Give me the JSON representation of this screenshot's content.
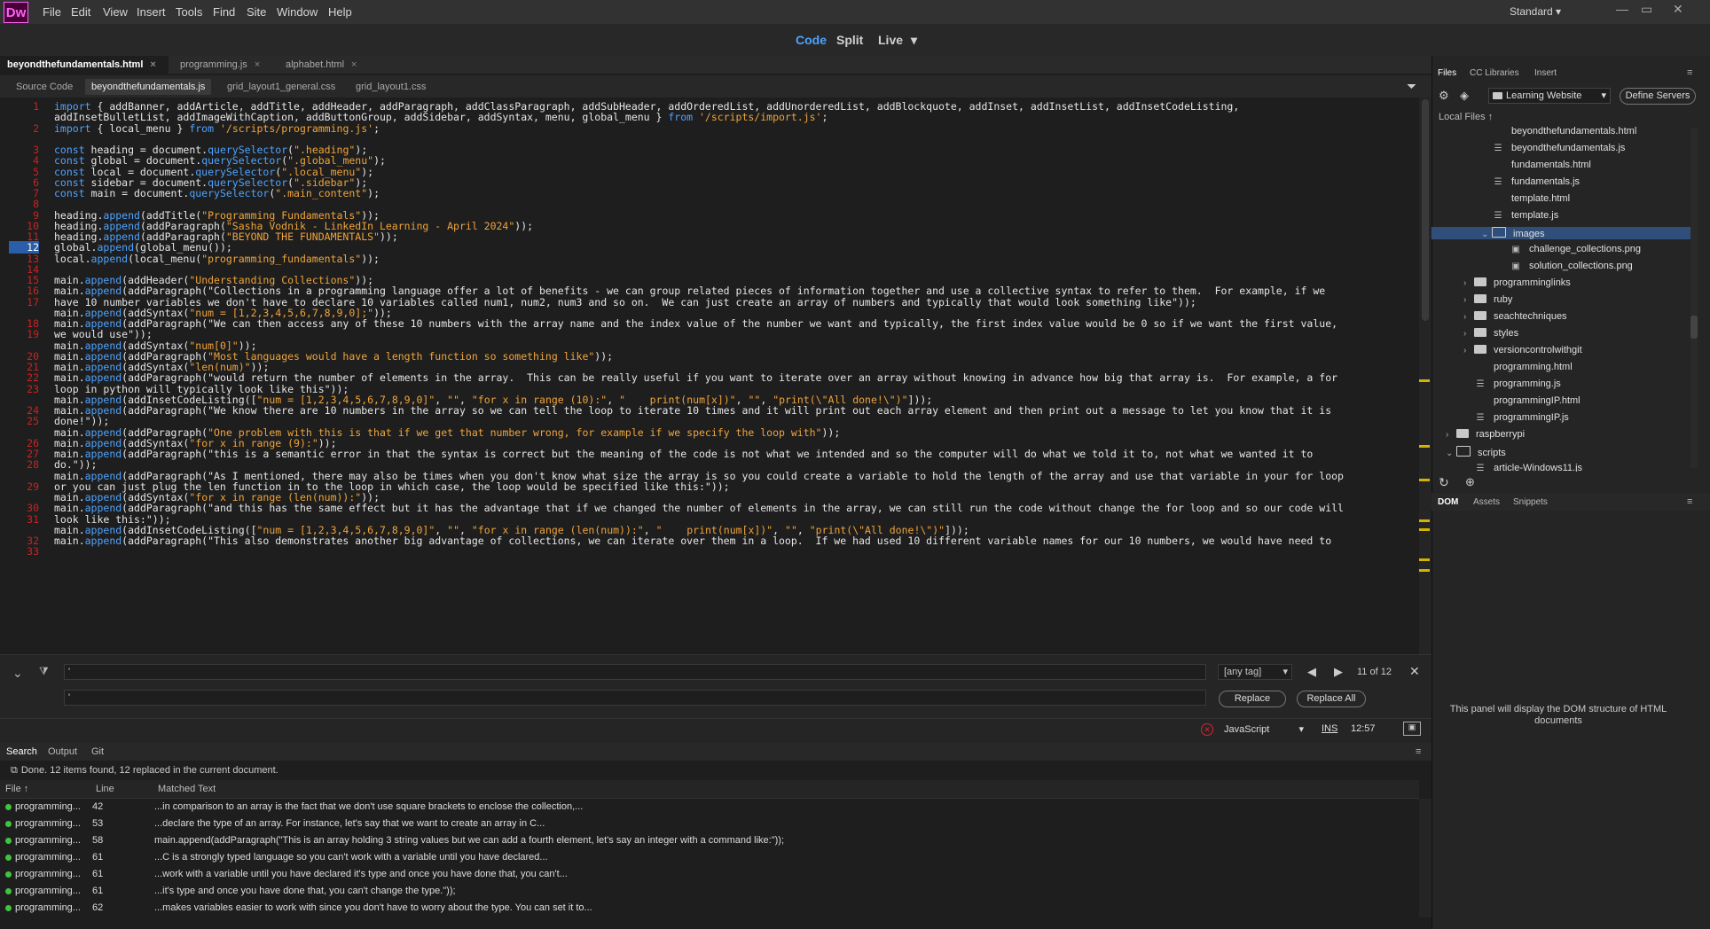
{
  "app": {
    "logo": "Dw",
    "menu": [
      "File",
      "Edit",
      "View",
      "Insert",
      "Tools",
      "Find",
      "Site",
      "Window",
      "Help"
    ],
    "workspace": "Standard",
    "workspace_arrow": "▾",
    "window_controls": [
      "—",
      "▭",
      "✕"
    ]
  },
  "view_modes": {
    "code": "Code",
    "split": "Split",
    "live": "Live",
    "live_arrow": "▾"
  },
  "doc_tabs": [
    {
      "label": "beyondthefundamentals.html",
      "close": "×"
    },
    {
      "label": "programming.js",
      "close": "×"
    },
    {
      "label": "alphabet.html",
      "close": "×"
    }
  ],
  "related_files": [
    "Source Code",
    "beyondthefundamentals.js",
    "grid_layout1_general.css",
    "grid_layout1.css"
  ],
  "filter_icon": "⏷",
  "code": {
    "line_numbers": [
      "1",
      "",
      "2",
      "",
      "3",
      "4",
      "5",
      "6",
      "7",
      "8",
      "9",
      "10",
      "11",
      "12",
      "13",
      "14",
      "15",
      "16",
      "17",
      "",
      "18",
      "19",
      "",
      "20",
      "21",
      "22",
      "23",
      "",
      "24",
      "25",
      "",
      "26",
      "27",
      "28",
      "",
      "29",
      "",
      "30",
      "31",
      "",
      "32",
      "33"
    ],
    "current_line": "12",
    "lines": [
      "import { addBanner, addArticle, addTitle, addHeader, addParagraph, addClassParagraph, addSubHeader, addOrderedList, addUnorderedList, addBlockquote, addInset, addInsetList, addInsetCodeListing,",
      "addInsetBulletList, addImageWithCaption, addButtonGroup, addSidebar, addSyntax, menu, global_menu } from '/scripts/import.js';",
      "import { local_menu } from '/scripts/programming.js';",
      "",
      "const heading = document.querySelector(\".heading\");",
      "const global = document.querySelector(\".global_menu\");",
      "const local = document.querySelector(\".local_menu\");",
      "const sidebar = document.querySelector(\".sidebar\");",
      "const main = document.querySelector(\".main_content\");",
      "",
      "heading.append(addTitle(\"Programming Fundamentals\"));",
      "heading.append(addParagraph(\"Sasha Vodnik - LinkedIn Learning - April 2024\"));",
      "heading.append(addParagraph(\"BEYOND THE FUNDAMENTALS\"));",
      "global.append(global_menu());",
      "local.append(local_menu(\"programming_fundamentals\"));",
      "",
      "main.append(addHeader(\"Understanding Collections\"));",
      "main.append(addParagraph(\"Collections in a programming language offer a lot of benefits - we can group related pieces of information together and use a collective syntax to refer to them.  For example, if we",
      "have 10 number variables we don't have to declare 10 variables called num1, num2, num3 and so on.  We can just create an array of numbers and typically that would look something like\"));",
      "main.append(addSyntax(\"num = [1,2,3,4,5,6,7,8,9,0];\"));",
      "main.append(addParagraph(\"We can then access any of these 10 numbers with the array name and the index value of the number we want and typically, the first index value would be 0 so if we want the first value,",
      "we would use\"));",
      "main.append(addSyntax(\"num[0]\"));",
      "main.append(addParagraph(\"Most languages would have a length function so something like\"));",
      "main.append(addSyntax(\"len(num)\"));",
      "main.append(addParagraph(\"would return the number of elements in the array.  This can be really useful if you want to iterate over an array without knowing in advance how big that array is.  For example, a for",
      "loop in python will typically look like this\"));",
      "main.append(addInsetCodeListing([\"num = [1,2,3,4,5,6,7,8,9,0]\", \"\", \"for x in range (10):\", \"    print(num[x])\", \"\", \"print(\\\"All done!\\\")\"]));",
      "main.append(addParagraph(\"We know there are 10 numbers in the array so we can tell the loop to iterate 10 times and it will print out each array element and then print out a message to let you know that it is",
      "done!\"));",
      "main.append(addParagraph(\"One problem with this is that if we get that number wrong, for example if we specify the loop with\"));",
      "main.append(addSyntax(\"for x in range (9):\"));",
      "main.append(addParagraph(\"this is a semantic error in that the syntax is correct but the meaning of the code is not what we intended and so the computer will do what we told it to, not what we wanted it to",
      "do.\"));",
      "main.append(addParagraph(\"As I mentioned, there may also be times when you don't know what size the array is so you could create a variable to hold the length of the array and use that variable in your for loop",
      "or you can just plug the len function in to the loop in which case, the loop would be specified like this:\"));",
      "main.append(addSyntax(\"for x in range (len(num)):\"));",
      "main.append(addParagraph(\"and this has the same effect but it has the advantage that if we changed the number of elements in the array, we can still run the code without change the for loop and so our code will",
      "look like this:\"));",
      "main.append(addInsetCodeListing([\"num = [1,2,3,4,5,6,7,8,9,0]\", \"\", \"for x in range (len(num)):\", \"    print(num[x])\", \"\", \"print(\\\"All done!\\\")\"]));",
      "main.append(addParagraph(\"This also demonstrates another big advantage of collections, we can iterate over them in a loop.  If we had used 10 different variable names for our 10 numbers, we would have need to"
    ]
  },
  "find": {
    "search_value": "'",
    "replace_value": "'",
    "tag_select": "[any tag]",
    "count": "11 of 12",
    "replace_label": "Replace",
    "replace_all_label": "Replace All",
    "close": "✕",
    "prev": "◀",
    "next": "▶",
    "collapse": "⌄"
  },
  "status": {
    "language": "JavaScript",
    "mode": "INS",
    "position": "12:57"
  },
  "bottom_tabs": [
    "Search",
    "Output",
    "Git"
  ],
  "search": {
    "message": "Done. 12 items found, 12 replaced in the current document.",
    "columns": [
      "File ↑",
      "Line",
      "Matched Text"
    ],
    "rows": [
      {
        "file": "programming...",
        "line": "42",
        "text": "...in comparison to an array is the fact that we don't use square brackets to enclose the collection,..."
      },
      {
        "file": "programming...",
        "line": "53",
        "text": "...declare the type of an array. For instance, let's say that we want to create an array in C..."
      },
      {
        "file": "programming...",
        "line": "58",
        "text": " main.append(addParagraph(\"This is an array holding 3 string values but we can add a fourth element, let's say an integer with a command like:\"));"
      },
      {
        "file": "programming...",
        "line": "61",
        "text": "...C is a strongly typed language so you can't work with a variable until you have declared..."
      },
      {
        "file": "programming...",
        "line": "61",
        "text": "...work with a variable until you have declared it's type and once you have done that, you can't..."
      },
      {
        "file": "programming...",
        "line": "61",
        "text": "...it's type and once you have done that, you can't change the type.\"));"
      },
      {
        "file": "programming...",
        "line": "62",
        "text": "...makes variables easier to work with since you don't have to worry about the type. You can set it to..."
      }
    ]
  },
  "files_panel": {
    "tabs": [
      "Files",
      "CC Libraries",
      "Insert"
    ],
    "site": "Learning Website",
    "define_servers": "Define Servers",
    "local_files": "Local Files ↑",
    "tree": [
      {
        "name": "beyondthefundamentals.html",
        "type": "html",
        "indent": 0
      },
      {
        "name": "beyondthefundamentals.js",
        "type": "js",
        "indent": 0
      },
      {
        "name": "fundamentals.html",
        "type": "html",
        "indent": 0
      },
      {
        "name": "fundamentals.js",
        "type": "js",
        "indent": 0
      },
      {
        "name": "template.html",
        "type": "html",
        "indent": 0
      },
      {
        "name": "template.js",
        "type": "js",
        "indent": 0
      },
      {
        "name": "images",
        "type": "folder-open",
        "indent": 0
      },
      {
        "name": "challenge_collections.png",
        "type": "img",
        "indent": 1
      },
      {
        "name": "solution_collections.png",
        "type": "img",
        "indent": 1
      },
      {
        "name": "programminglinks",
        "type": "folder",
        "indent": -1
      },
      {
        "name": "ruby",
        "type": "folder",
        "indent": -1
      },
      {
        "name": "seachtechniques",
        "type": "folder",
        "indent": -1
      },
      {
        "name": "styles",
        "type": "folder",
        "indent": -1
      },
      {
        "name": "versioncontrolwithgit",
        "type": "folder",
        "indent": -1
      },
      {
        "name": "programming.html",
        "type": "html",
        "indent": -1
      },
      {
        "name": "programming.js",
        "type": "js",
        "indent": -1
      },
      {
        "name": "programmingIP.html",
        "type": "html",
        "indent": -1
      },
      {
        "name": "programmingIP.js",
        "type": "js",
        "indent": -1
      },
      {
        "name": "raspberrypi",
        "type": "folder",
        "indent": -2
      },
      {
        "name": "scripts",
        "type": "folder-open",
        "indent": -2
      },
      {
        "name": "article-Windows11.js",
        "type": "js",
        "indent": -1
      }
    ]
  },
  "dom_panel": {
    "tabs": [
      "DOM",
      "Assets",
      "Snippets"
    ],
    "message": "This panel will display the DOM structure of HTML documents"
  },
  "colors": {
    "accent": "#4ea3ff",
    "string": "#f0a43a",
    "line_number": "#cc2222",
    "logo_bg": "#470137",
    "logo_fg": "#ff61f6"
  }
}
